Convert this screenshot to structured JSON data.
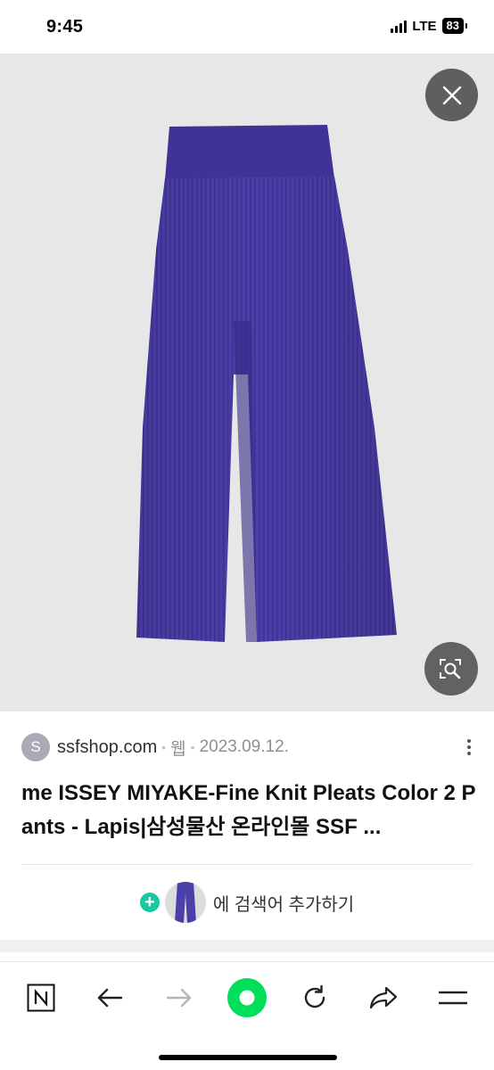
{
  "status": {
    "time": "9:45",
    "network": "LTE",
    "battery": "83"
  },
  "viewer": {
    "product": "product-image",
    "close_icon": "close-icon",
    "lens_icon": "image-search-icon"
  },
  "result": {
    "favicon_letter": "S",
    "site": "ssfshop.com",
    "type": "웹",
    "date": "2023.09.12.",
    "title": "me ISSEY MIYAKE-Fine Knit Pleats Color 2 Pants - Lapis|삼성물산 온라인몰 SSF ...",
    "add_keyword": "에 검색어 추가하기"
  },
  "bottom_nav": [
    "naver-home-icon",
    "back-icon",
    "forward-icon",
    "green-dot-icon",
    "reload-icon",
    "share-icon",
    "menu-icon"
  ],
  "colors": {
    "pants": "#4a3fa8",
    "accent_green": "#00de5a",
    "plus_teal": "#16c9a2"
  }
}
